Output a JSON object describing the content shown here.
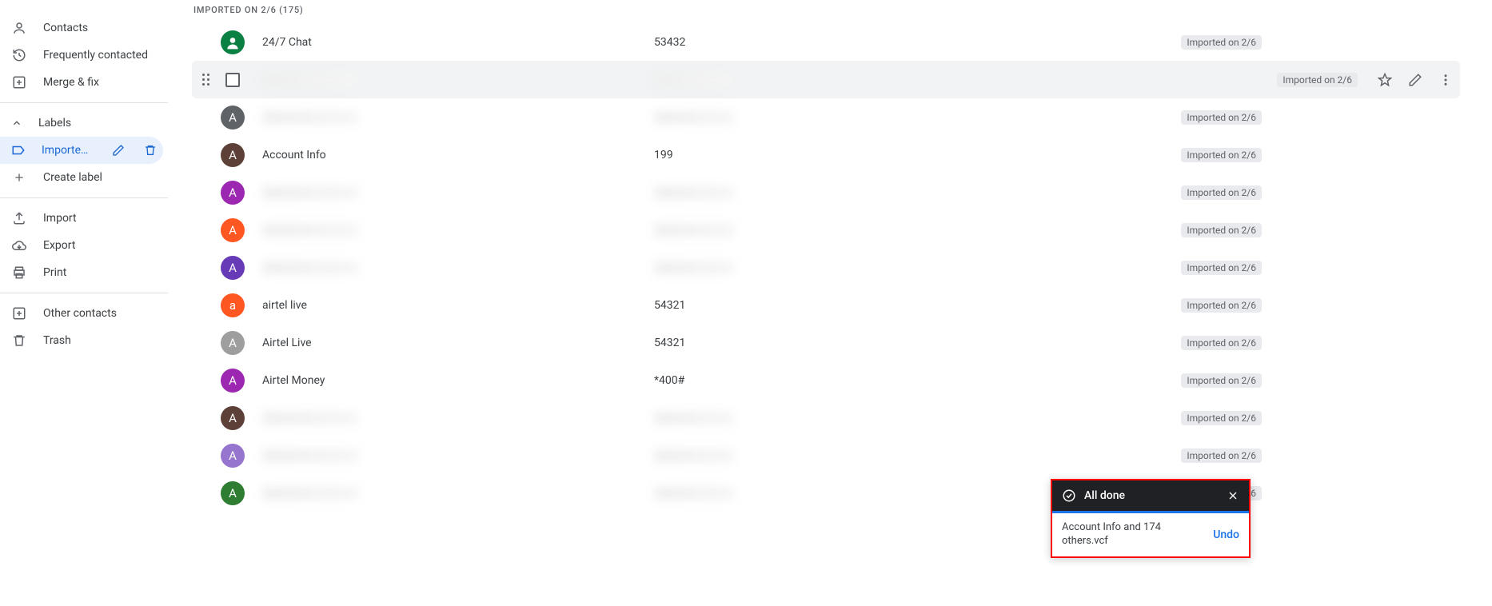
{
  "sidebar": {
    "contacts": "Contacts",
    "frequent": "Frequently contacted",
    "mergefix": "Merge & fix",
    "labels_header": "Labels",
    "imported_label": "Imported on 2/6",
    "create_label": "Create label",
    "import": "Import",
    "export": "Export",
    "print": "Print",
    "other": "Other contacts",
    "trash": "Trash"
  },
  "main": {
    "section_header": "IMPORTED ON 2/6 (175)",
    "rows": [
      {
        "avatar_letter": "",
        "avatar_color": "#0b8043",
        "avatar_icon": true,
        "name": "24/7 Chat",
        "phone": "53432",
        "label": "Imported on 2/6",
        "blurred": false
      },
      {
        "avatar_letter": "",
        "avatar_color": "#ffffff",
        "name": "",
        "phone": "",
        "label": "Imported on 2/6",
        "blurred": true,
        "hovered": true,
        "checkbox": true
      },
      {
        "avatar_letter": "A",
        "avatar_color": "#5f6368",
        "name": "",
        "phone": "",
        "label": "Imported on 2/6",
        "blurred": true
      },
      {
        "avatar_letter": "A",
        "avatar_color": "#5d4037",
        "name": "Account Info",
        "phone": "199",
        "label": "Imported on 2/6",
        "blurred": false
      },
      {
        "avatar_letter": "A",
        "avatar_color": "#9c27b0",
        "name": "",
        "phone": "",
        "label": "Imported on 2/6",
        "blurred": true
      },
      {
        "avatar_letter": "A",
        "avatar_color": "#ff5722",
        "name": "",
        "phone": "",
        "label": "Imported on 2/6",
        "blurred": true
      },
      {
        "avatar_letter": "A",
        "avatar_color": "#673ab7",
        "name": "",
        "phone": "",
        "label": "Imported on 2/6",
        "blurred": true
      },
      {
        "avatar_letter": "a",
        "avatar_color": "#ff5722",
        "name": "airtel live",
        "phone": "54321",
        "label": "Imported on 2/6",
        "blurred": false
      },
      {
        "avatar_letter": "A",
        "avatar_color": "#9e9e9e",
        "name": "Airtel Live",
        "phone": "54321",
        "label": "Imported on 2/6",
        "blurred": false
      },
      {
        "avatar_letter": "A",
        "avatar_color": "#9c27b0",
        "name": "Airtel Money",
        "phone": "*400#",
        "label": "Imported on 2/6",
        "blurred": false
      },
      {
        "avatar_letter": "A",
        "avatar_color": "#5d4037",
        "name": "",
        "phone": "",
        "label": "Imported on 2/6",
        "blurred": true
      },
      {
        "avatar_letter": "A",
        "avatar_color": "#9575cd",
        "name": "",
        "phone": "",
        "label": "Imported on 2/6",
        "blurred": true
      },
      {
        "avatar_letter": "A",
        "avatar_color": "#2e7d32",
        "name": "",
        "phone": "",
        "label": "Imported on 2/6",
        "blurred": true
      }
    ]
  },
  "toast": {
    "title": "All done",
    "message": "Account Info and 174 others.vcf",
    "undo": "Undo"
  }
}
